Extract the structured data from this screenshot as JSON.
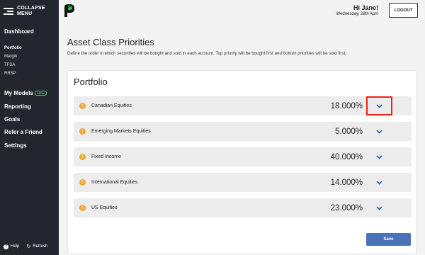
{
  "sidebar": {
    "collapse_line1": "COLLAPSE",
    "collapse_line2": "MENU",
    "dashboard": "Dashboard",
    "portfolio": "Portfolio",
    "margin": "Margin",
    "tfsa": "TFSA",
    "rrsp": "RRSP",
    "my_models": "My Models",
    "my_models_tag": "NEW",
    "reporting": "Reporting",
    "goals": "Goals",
    "refer": "Refer a Friend",
    "settings": "Settings",
    "help": "Help",
    "refresh": "Refresh"
  },
  "header": {
    "greeting": "Hi Jane!",
    "date": "Wednesday, 28th April",
    "logout": "LOGOUT"
  },
  "page": {
    "title": "Asset Class Priorities",
    "description": "Define the order in which securities will be bought and sold in each account. Top priority will be bought first and bottom priorities will be sold first."
  },
  "card": {
    "title": "Portfolio",
    "rows": [
      {
        "name": "Canadian Equities",
        "percent": "18.000%"
      },
      {
        "name": "Emerging Markets Equities",
        "percent": "5.000%"
      },
      {
        "name": "Fixed Income",
        "percent": "40.000%"
      },
      {
        "name": "International Equities",
        "percent": "14.000%"
      },
      {
        "name": "US Equities",
        "percent": "23.000%"
      }
    ],
    "save": "Save"
  },
  "icons": {
    "warning": "exclamation-circle-icon",
    "chevron": "chevron-down-icon",
    "logo": "leaf-p-logo"
  },
  "colors": {
    "sidebar_bg": "#23262d",
    "accent_blue": "#4a73b7",
    "warning": "#f5a623",
    "highlight": "#e8241b",
    "logo_green": "#2fb54a"
  }
}
